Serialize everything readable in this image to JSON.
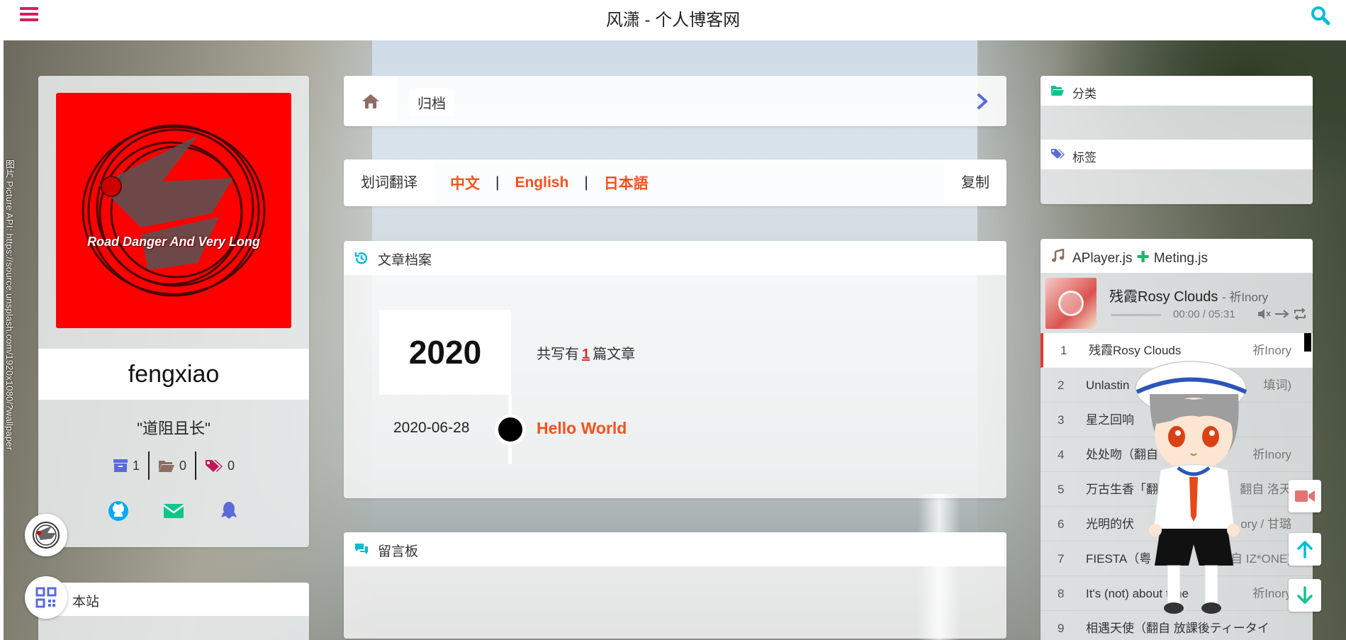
{
  "header": {
    "title": "风潇 - 个人博客网"
  },
  "background": {
    "credit": "图片 Picture API: https://source.unsplash.com/1920x1080/?wallpaper"
  },
  "profile": {
    "avatar_text": "Road Danger And Very Long",
    "name": "fengxiao",
    "motto": "\"道阻且长\"",
    "stats": {
      "archives": "1",
      "categories": "0",
      "tags": "0"
    }
  },
  "site_panel": {
    "label": "本站"
  },
  "breadcrumb": {
    "current": "归档"
  },
  "translate": {
    "label": "划词翻译",
    "langs": [
      "中文",
      "English",
      "日本語"
    ],
    "copy_label": "复制"
  },
  "archive": {
    "title": "文章档案",
    "year": "2020",
    "summary_prefix": "共写有",
    "summary_count": "1",
    "summary_suffix": "篇文章",
    "posts": [
      {
        "date": "2020-06-28",
        "title": "Hello World"
      }
    ]
  },
  "guestbook": {
    "title": "留言板"
  },
  "sidebar": {
    "categories_title": "分类",
    "tags_title": "标签"
  },
  "player": {
    "header_left": "APlayer.js",
    "header_right": "Meting.js",
    "now_playing": {
      "title": "残霞Rosy Clouds",
      "artist": "- 祈Inory",
      "time": "00:00 / 05:31",
      "progress": 0.0
    },
    "playlist": [
      {
        "index": "1",
        "name": "残霞Rosy Clouds",
        "artist": "祈Inory"
      },
      {
        "index": "2",
        "name": "Unlastin",
        "artist": "填词)"
      },
      {
        "index": "3",
        "name": "星之回响",
        "artist": ""
      },
      {
        "index": "4",
        "name": "处处吻（翻自",
        "artist": "祈Inory"
      },
      {
        "index": "5",
        "name": "万古生香「翻",
        "artist": "翻自 洛天"
      },
      {
        "index": "6",
        "name": "光明的伏",
        "artist": "ory / 甘璐"
      },
      {
        "index": "7",
        "name": "FIESTA（粤",
        "artist": "翻自 IZ*ONE)"
      },
      {
        "index": "8",
        "name": "It's (not) about time",
        "artist": "祈Inory"
      },
      {
        "index": "9",
        "name": "相遇天使（翻自 放課後ティータイ",
        "artist": ""
      }
    ]
  },
  "colors": {
    "accent": "#f4511e",
    "menu": "#d81b60",
    "search": "#00bcd4",
    "count": "#d32f2f"
  }
}
